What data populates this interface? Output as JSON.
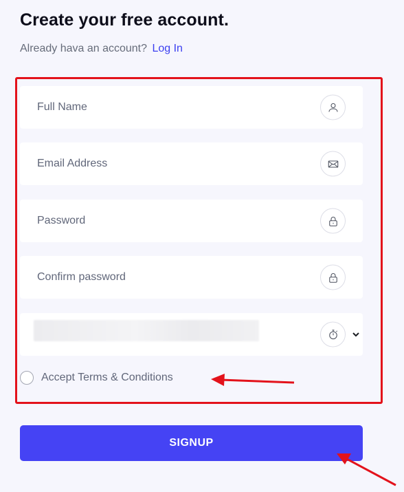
{
  "header": {
    "title": "Create your free account.",
    "subtitle_prefix": "Already hava an account?",
    "login_link": "Log In"
  },
  "form": {
    "fields": [
      {
        "label": "Full Name",
        "icon": "user-icon"
      },
      {
        "label": "Email Address",
        "icon": "envelope-icon"
      },
      {
        "label": "Password",
        "icon": "lock-icon"
      },
      {
        "label": "Confirm password",
        "icon": "lock-icon"
      }
    ],
    "timezone_select": {
      "icon": "stopwatch-icon",
      "dropdown_icon": "chevron-down-icon",
      "value_obscured": true
    },
    "terms_label": "Accept Terms & Conditions",
    "terms_checked": false
  },
  "signup_label": "SIGNUP",
  "colors": {
    "background": "#f6f6fd",
    "accent": "#4543f4",
    "link": "#3b3ff0",
    "annotation": "#e3121b"
  }
}
